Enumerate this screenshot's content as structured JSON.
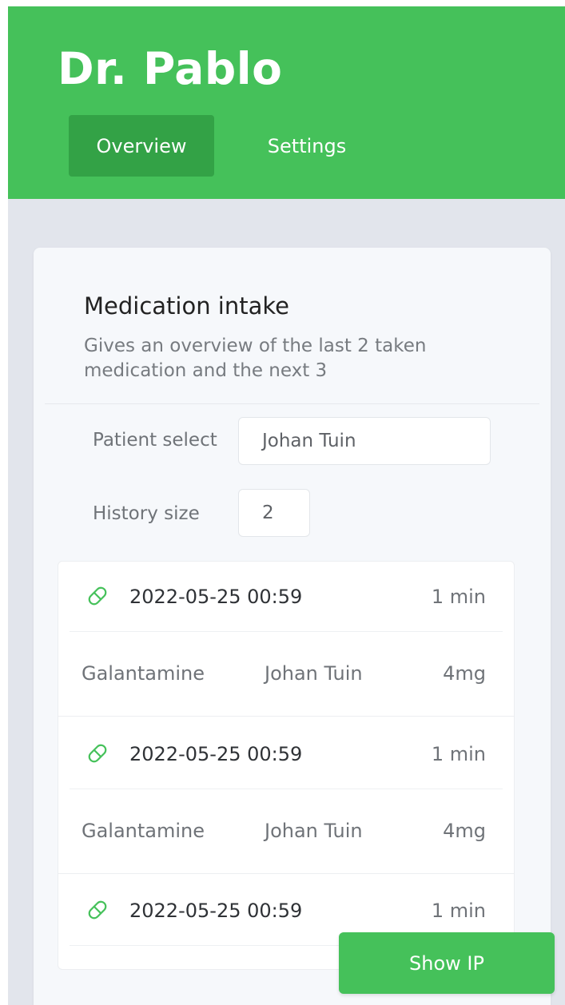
{
  "header": {
    "title": "Dr. Pablo",
    "tabs": [
      {
        "label": "Overview",
        "active": true
      },
      {
        "label": "Settings",
        "active": false
      }
    ]
  },
  "card": {
    "title": "Medication intake",
    "subtitle": "Gives an overview of the last 2 taken medication and the next 3",
    "patient_select": {
      "label": "Patient select",
      "value": "Johan Tuin"
    },
    "history_size": {
      "label": "History size",
      "value": "2"
    }
  },
  "entries": [
    {
      "time": "2022-05-25 00:59",
      "duration": "1 min",
      "medication": "Galantamine",
      "patient": "Johan Tuin",
      "dose": "4mg"
    },
    {
      "time": "2022-05-25 00:59",
      "duration": "1 min",
      "medication": "Galantamine",
      "patient": "Johan Tuin",
      "dose": "4mg"
    },
    {
      "time": "2022-05-25 00:59",
      "duration": "1 min"
    }
  ],
  "fab": {
    "label": "Show IP"
  },
  "colors": {
    "brand": "#45c15a",
    "tab_active": "#33a246",
    "background": "#e2e5ec",
    "pill_icon": "#45c15a"
  },
  "icons": {
    "entry": "pill-icon"
  }
}
